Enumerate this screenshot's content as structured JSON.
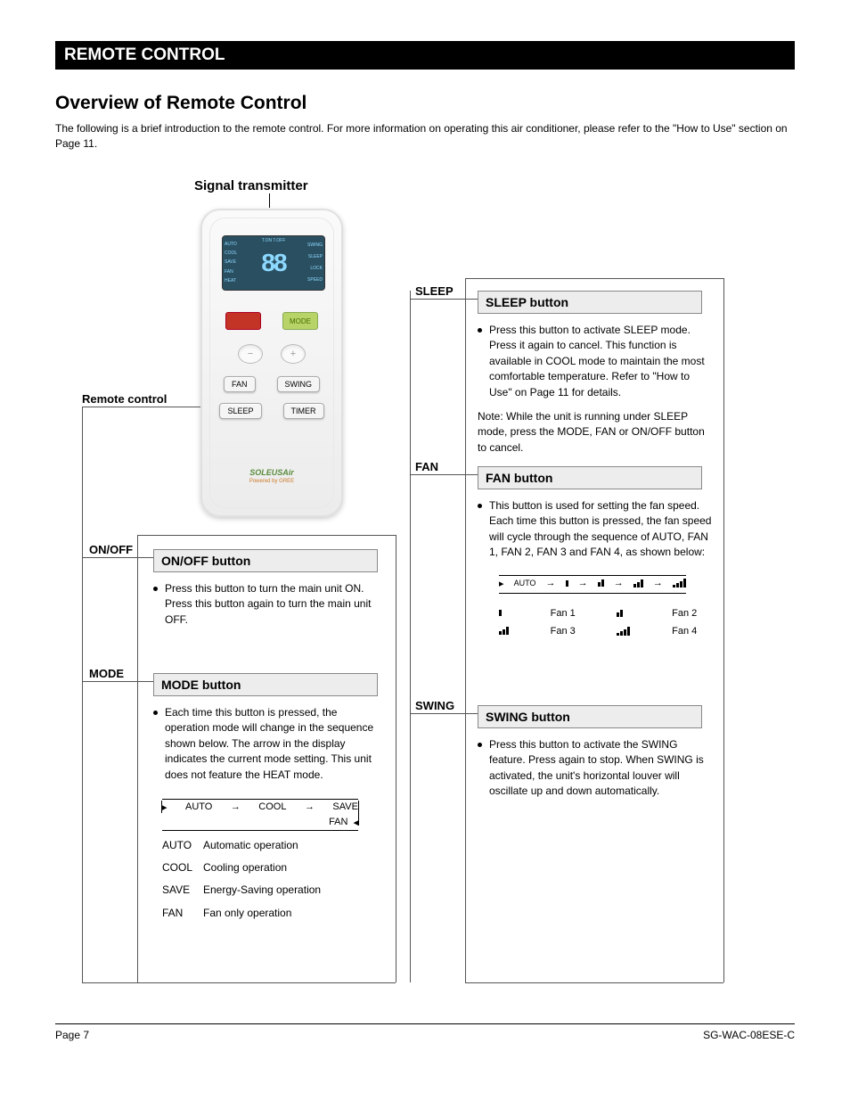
{
  "header_bar": "REMOTE CONTROL",
  "section_title": "Overview of Remote Control",
  "subtitle": "The following is a brief introduction to the remote control. For more information on operating this air conditioner, please refer to the \"How to Use\" section on Page 11.",
  "signal_label": "Signal transmitter",
  "remote_control_label": "Remote control",
  "remote": {
    "lcd_top": "T.ON   T.OFF",
    "lcd_left": [
      "AUTO",
      "COOL",
      "SAVE",
      "FAN",
      "HEAT"
    ],
    "lcd_mid": "88",
    "lcd_right": [
      "SWING",
      "SLEEP",
      "LOCK",
      "SPEED"
    ],
    "onoff": "",
    "mode": "MODE",
    "minus": "−",
    "plus": "+",
    "fan": "FAN",
    "swing": "SWING",
    "sleep": "SLEEP",
    "timer": "TIMER",
    "logo1": "SOLEUSAir",
    "logo2": "Powered by GREE"
  },
  "pins": {
    "onoff": "ON/OFF",
    "mode": "MODE",
    "sleep": "SLEEP",
    "fan": "FAN",
    "swing": "SWING"
  },
  "blocks": {
    "onoff": {
      "title": "ON/OFF button",
      "body": "Press this button to turn the main unit ON. Press this button again to turn the main unit OFF."
    },
    "mode": {
      "title": "MODE button",
      "body": "Each time this button is pressed, the operation mode will change in the sequence shown below. The arrow in the display indicates the current mode setting. This unit does not feature the HEAT mode.",
      "flow": [
        "AUTO",
        "COOL",
        "SAVE",
        "FAN"
      ],
      "list": [
        {
          "k": "AUTO",
          "v": "Automatic operation"
        },
        {
          "k": "COOL",
          "v": "Cooling operation"
        },
        {
          "k": "SAVE",
          "v": "Energy-Saving operation"
        },
        {
          "k": "FAN",
          "v": "Fan only operation"
        }
      ]
    },
    "sleep": {
      "title": "SLEEP button",
      "body": "Press this button to activate SLEEP mode. Press it again to cancel. This function is available in COOL mode to maintain the most comfortable temperature. Refer to \"How to Use\" on Page 11 for details.",
      "note": "Note: While the unit is running under SLEEP mode, press the MODE, FAN or ON/OFF button to cancel."
    },
    "fan": {
      "title": "FAN button",
      "body": "This button is used for setting the fan speed. Each time this button is pressed, the fan speed will cycle through the sequence of AUTO, FAN 1, FAN 2, FAN 3 and FAN 4, as shown below:",
      "auto": "AUTO",
      "labels": [
        "Fan 1",
        "Fan 2",
        "Fan 3",
        "Fan 4"
      ]
    },
    "swing": {
      "title": "SWING button",
      "body": "Press this button to activate the SWING feature. Press again to stop. When SWING is activated, the unit's horizontal louver will oscillate up and down automatically."
    }
  },
  "footer": {
    "page": "Page 7",
    "model": "SG-WAC-08ESE-C"
  }
}
